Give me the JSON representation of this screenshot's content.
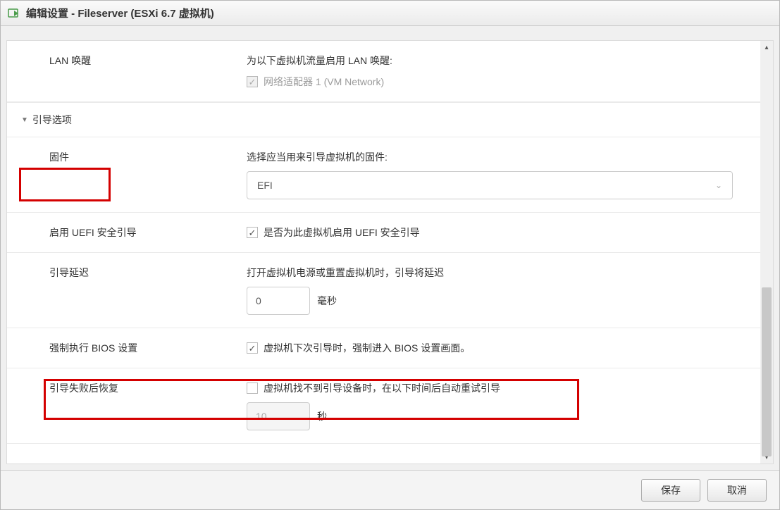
{
  "window": {
    "title": "编辑设置 - Fileserver (ESXi 6.7 虚拟机)"
  },
  "lan_wake": {
    "label": "LAN 唤醒",
    "description": "为以下虚拟机流量启用 LAN 唤醒:",
    "adapter_label": "网络适配器 1 (VM Network)"
  },
  "boot_section": {
    "title": "引导选项"
  },
  "firmware": {
    "label": "固件",
    "description": "选择应当用来引导虚拟机的固件:",
    "selected": "EFI"
  },
  "secure_boot": {
    "label": "启用 UEFI 安全引导",
    "checkbox_label": "是否为此虚拟机启用 UEFI 安全引导"
  },
  "boot_delay": {
    "label": "引导延迟",
    "description": "打开虚拟机电源或重置虚拟机时，引导将延迟",
    "value": "0",
    "unit": "毫秒"
  },
  "force_bios": {
    "label": "强制执行 BIOS 设置",
    "checkbox_label": "虚拟机下次引导时，强制进入 BIOS 设置画面。"
  },
  "boot_recovery": {
    "label": "引导失败后恢复",
    "checkbox_label": "虚拟机找不到引导设备时，在以下时间后自动重试引导",
    "value": "10",
    "unit": "秒"
  },
  "footer": {
    "save": "保存",
    "cancel": "取消"
  }
}
